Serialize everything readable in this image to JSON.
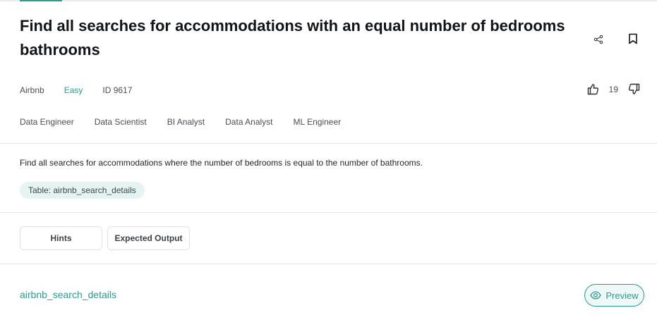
{
  "question": {
    "title": "Find all searches for accommodations with an equal number of bedrooms bathrooms",
    "company": "Airbnb",
    "difficulty": "Easy",
    "id_label": "ID 9617",
    "vote_count": "19",
    "roles": [
      "Data Engineer",
      "Data Scientist",
      "BI Analyst",
      "Data Analyst",
      "ML Engineer"
    ],
    "description": "Find all searches for accommodations where the number of bedrooms is equal to the number of bathrooms.",
    "table_chip": "Table: airbnb_search_details"
  },
  "tabs": {
    "hints_label": "Hints",
    "expected_output_label": "Expected Output"
  },
  "dataset": {
    "name": "airbnb_search_details",
    "preview_label": "Preview"
  },
  "icons": {
    "share": "share-icon",
    "bookmark": "bookmark-icon",
    "thumbs_up": "thumbs-up-icon",
    "thumbs_down": "thumbs-down-icon",
    "eye": "eye-icon"
  },
  "colors": {
    "accent": "#2a9d8f",
    "chip_bg": "#e6f4f1",
    "title": "#111418"
  }
}
